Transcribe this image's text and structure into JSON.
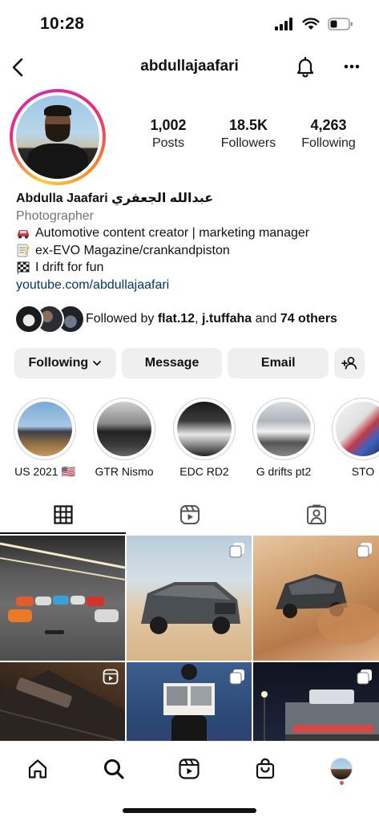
{
  "status": {
    "time": "10:28"
  },
  "header": {
    "username": "abdullajaafari"
  },
  "profile": {
    "stats": [
      {
        "value": "1,002",
        "label": "Posts"
      },
      {
        "value": "18.5K",
        "label": "Followers"
      },
      {
        "value": "4,263",
        "label": "Following"
      }
    ],
    "name": "Abdulla Jaafari عبدالله الجعفري",
    "category": "Photographer",
    "bio_lines": [
      "Automotive content creator | marketing manager",
      "ex-EVO Magazine/crankandpiston",
      "I drift for fun"
    ],
    "link": "youtube.com/abdullajaafari"
  },
  "followed_by": {
    "prefix": "Followed by",
    "user1": "flat.12",
    "sep": ",",
    "user2": "j.tuffaha",
    "and": "and",
    "others": "74 others"
  },
  "actions": {
    "following": "Following",
    "message": "Message",
    "email": "Email"
  },
  "highlights": [
    {
      "label": "US 2021 🇺🇸"
    },
    {
      "label": "GTR Nismo"
    },
    {
      "label": "EDC RD2"
    },
    {
      "label": "G drifts pt2"
    },
    {
      "label": "STO"
    }
  ],
  "tabs": [
    "posts-grid-icon",
    "reels-icon",
    "tagged-icon"
  ],
  "colors": {
    "link": "#00376b",
    "button_bg": "#efefef",
    "notification": "#ed4956"
  }
}
